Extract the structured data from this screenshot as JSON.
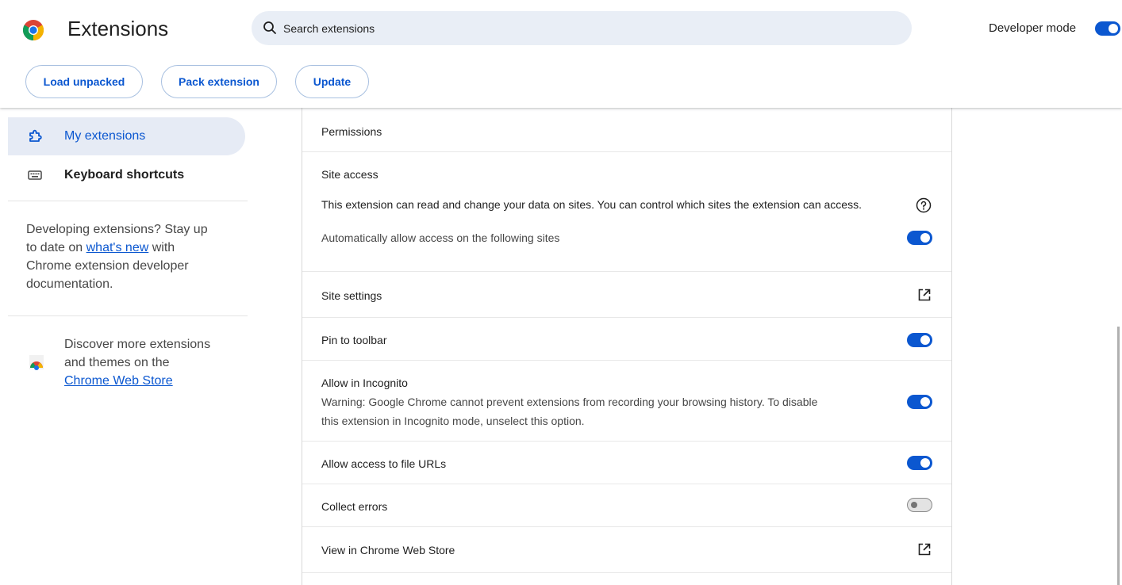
{
  "header": {
    "title": "Extensions",
    "search_placeholder": "Search extensions",
    "developer_mode_label": "Developer mode",
    "developer_mode_on": true,
    "buttons": {
      "load_unpacked": "Load unpacked",
      "pack_extension": "Pack extension",
      "update": "Update"
    }
  },
  "sidebar": {
    "items": [
      {
        "label": "My extensions",
        "icon": "puzzle-icon",
        "active": true
      },
      {
        "label": "Keyboard shortcuts",
        "icon": "keyboard-icon",
        "active": false
      }
    ],
    "dev_promo": {
      "line1": "Developing extensions? Stay up",
      "line2_prefix": "to date on ",
      "link": "what's new",
      "line2_suffix": " with",
      "line3": "Chrome extension developer",
      "line4": "documentation."
    },
    "store_promo": {
      "line1": "Discover more extensions",
      "line2": "and themes on the",
      "link": "Chrome Web Store"
    }
  },
  "details": {
    "permissions_label": "Permissions",
    "site_access": {
      "title": "Site access",
      "description": "This extension can read and change your data on sites. You can control which sites the extension can access.",
      "auto_allow_label": "Automatically allow access on the following sites",
      "auto_allow_on": true
    },
    "site_settings_label": "Site settings",
    "pin_to_toolbar": {
      "label": "Pin to toolbar",
      "on": true
    },
    "incognito": {
      "label": "Allow in Incognito",
      "warning_line1": "Warning: Google Chrome cannot prevent extensions from recording your browsing history. To disable",
      "warning_line2": "this extension in Incognito mode, unselect this option.",
      "on": true
    },
    "file_urls": {
      "label": "Allow access to file URLs",
      "on": true
    },
    "collect_errors": {
      "label": "Collect errors",
      "on": false
    },
    "web_store_label": "View in Chrome Web Store"
  },
  "colors": {
    "accent": "#0b57d0",
    "search_bg": "#e9eef6",
    "active_nav_bg": "#e6ebf5"
  }
}
